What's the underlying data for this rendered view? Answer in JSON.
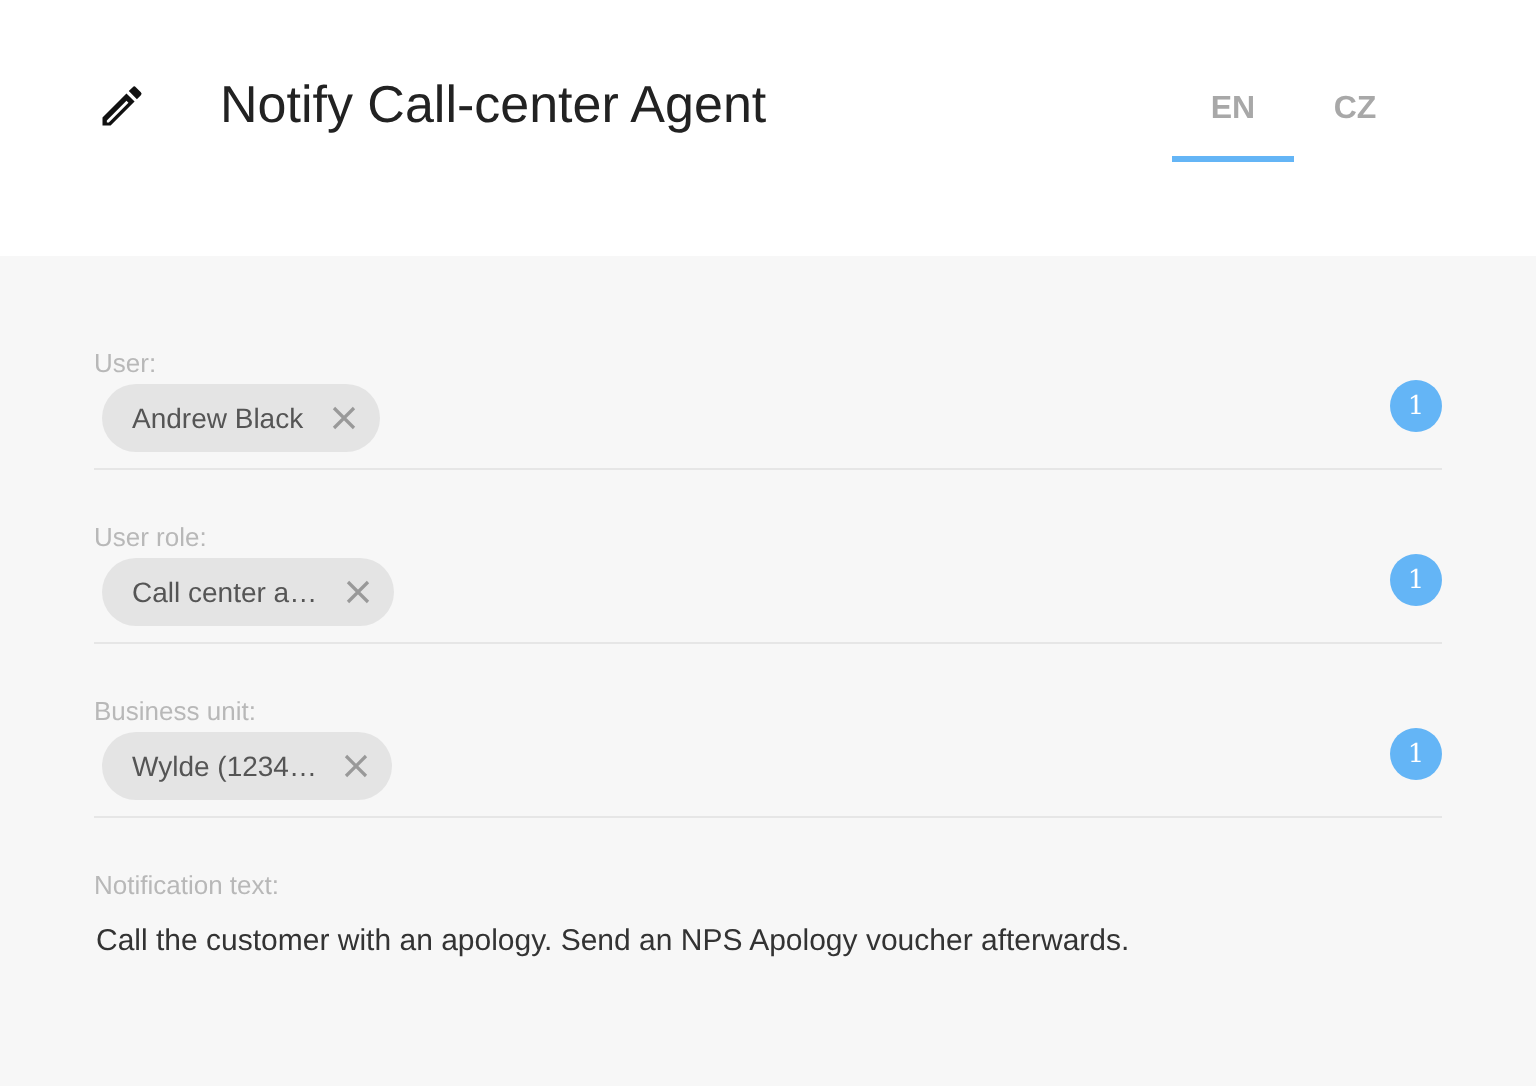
{
  "header": {
    "title": "Notify Call-center Agent"
  },
  "tabs": [
    {
      "label": "EN",
      "selected": true
    },
    {
      "label": "CZ",
      "selected": false
    }
  ],
  "fields": [
    {
      "label": "User:",
      "chips": [
        "Andrew Black"
      ],
      "count": "1"
    },
    {
      "label": "User role:",
      "chips": [
        "Call center a…"
      ],
      "count": "1"
    },
    {
      "label": "Business unit:",
      "chips": [
        "Wylde (1234…"
      ],
      "count": "1"
    }
  ],
  "notification": {
    "label": "Notification text:",
    "text": "Call the customer with an apology. Send an NPS Apology voucher afterwards."
  }
}
